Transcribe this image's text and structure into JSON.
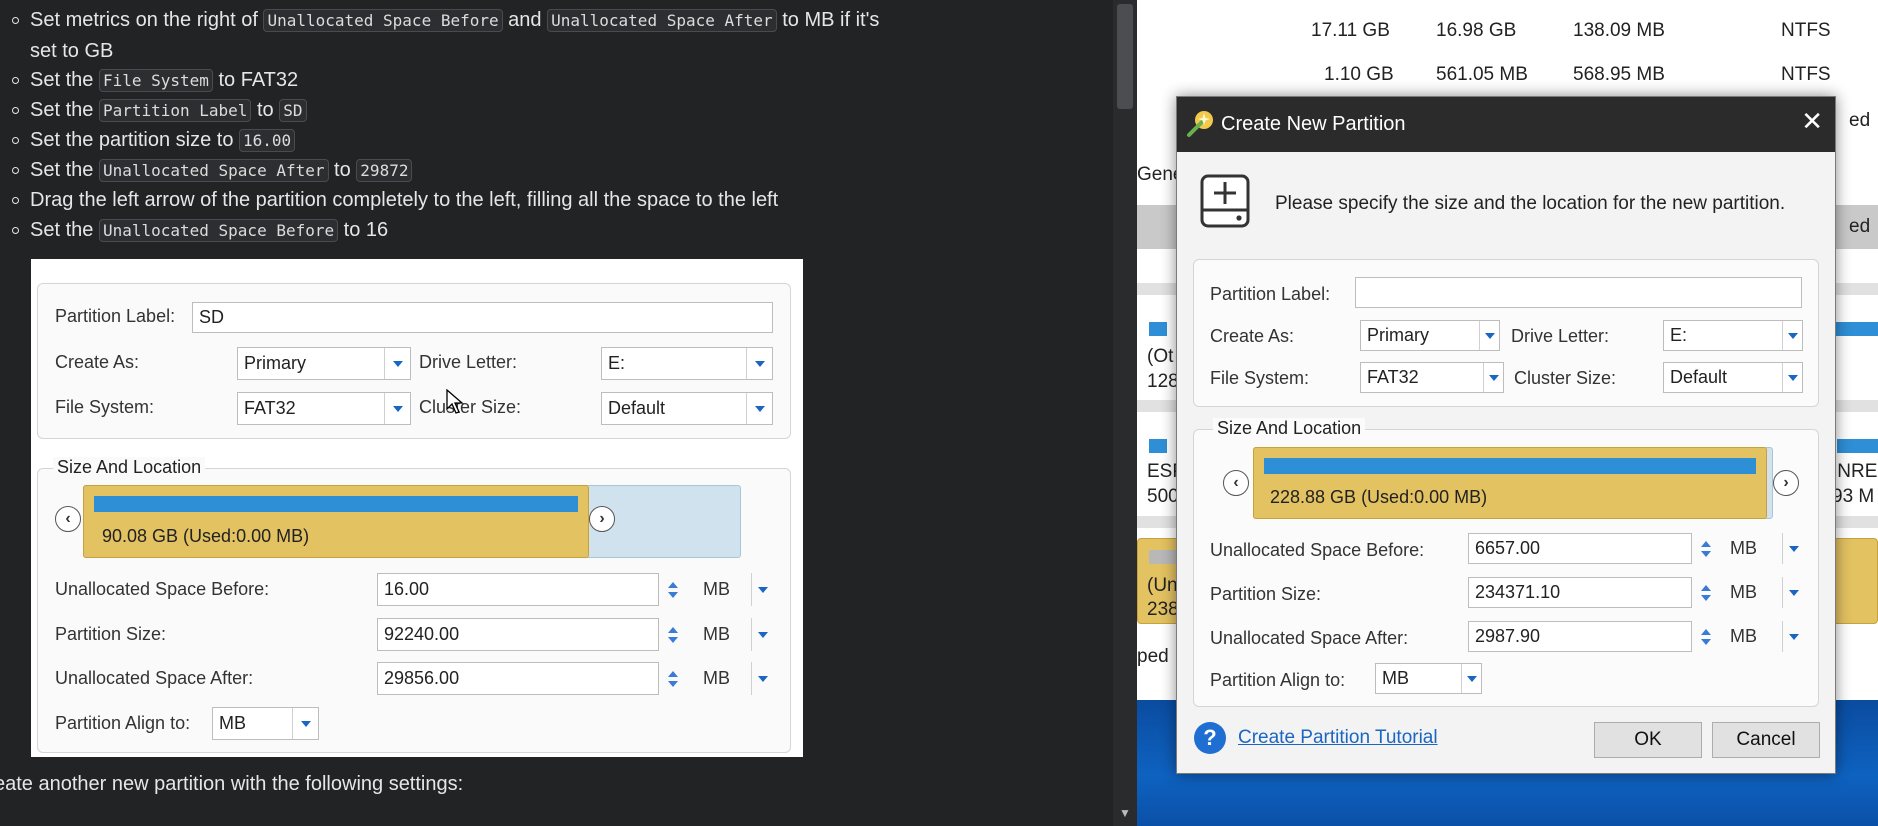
{
  "doc": {
    "bullets": [
      {
        "parts": [
          {
            "t": "text",
            "v": "Set metrics on the right of "
          },
          {
            "t": "code",
            "v": "Unallocated Space Before"
          },
          {
            "t": "text",
            "v": " and "
          },
          {
            "t": "code",
            "v": "Unallocated Space After"
          },
          {
            "t": "text",
            "v": " to MB if it's"
          }
        ],
        "cont": "set to GB"
      },
      {
        "parts": [
          {
            "t": "text",
            "v": "Set the "
          },
          {
            "t": "code",
            "v": "File System"
          },
          {
            "t": "text",
            "v": " to FAT32"
          }
        ]
      },
      {
        "parts": [
          {
            "t": "text",
            "v": "Set the "
          },
          {
            "t": "code",
            "v": "Partition Label"
          },
          {
            "t": "text",
            "v": " to "
          },
          {
            "t": "code",
            "v": "SD"
          }
        ]
      },
      {
        "parts": [
          {
            "t": "text",
            "v": "Set the partition size to "
          },
          {
            "t": "code",
            "v": "16.00"
          }
        ]
      },
      {
        "parts": [
          {
            "t": "text",
            "v": "Set the "
          },
          {
            "t": "code",
            "v": "Unallocated Space After"
          },
          {
            "t": "text",
            "v": " to "
          },
          {
            "t": "code",
            "v": "29872"
          }
        ]
      },
      {
        "parts": [
          {
            "t": "text",
            "v": "Drag the left arrow of the partition completely to the left, filling all the space to the left"
          }
        ]
      },
      {
        "parts": [
          {
            "t": "text",
            "v": "Set the "
          },
          {
            "t": "code",
            "v": "Unallocated Space Before"
          },
          {
            "t": "text",
            "v": " to 16"
          }
        ]
      }
    ],
    "bottom_text": "eate another new partition with the following settings:"
  },
  "embedded": {
    "partition_label_lbl": "Partition Label:",
    "partition_label_val": "SD",
    "create_as_lbl": "Create As:",
    "create_as_val": "Primary",
    "drive_letter_lbl": "Drive Letter:",
    "drive_letter_val": "E:",
    "file_system_lbl": "File System:",
    "file_system_val": "FAT32",
    "cluster_size_lbl": "Cluster Size:",
    "cluster_size_val": "Default",
    "size_location_lbl": "Size And Location",
    "bar_text": "90.08 GB (Used:0.00 MB)",
    "uns_before_lbl": "Unallocated Space Before:",
    "uns_before_val": "16.00",
    "part_size_lbl": "Partition Size:",
    "part_size_val": "92240.00",
    "uns_after_lbl": "Unallocated Space After:",
    "uns_after_val": "29856.00",
    "unit": "MB",
    "align_lbl": "Partition Align to:",
    "align_val": "MB"
  },
  "bgapp": {
    "rows": [
      {
        "cap": "17.11 GB",
        "used": "16.98 GB",
        "unused": "138.09 MB",
        "fs": "NTFS"
      },
      {
        "cap": "1.10 GB",
        "used": "561.05 MB",
        "unused": "568.95 MB",
        "fs": "NTFS"
      }
    ],
    "frags": [
      "ed",
      "Gene",
      "ed",
      "(Ot",
      "128",
      "ESP",
      "500",
      "INRE",
      "93 M",
      "(Un",
      "238",
      "ped"
    ]
  },
  "dialog": {
    "title": "Create New Partition",
    "close": "✕",
    "instruction": "Please specify the size and the location for the new partition.",
    "partition_label_lbl": "Partition Label:",
    "partition_label_val": "",
    "create_as_lbl": "Create As:",
    "create_as_val": "Primary",
    "drive_letter_lbl": "Drive Letter:",
    "drive_letter_val": "E:",
    "file_system_lbl": "File System:",
    "file_system_val": "FAT32",
    "cluster_size_lbl": "Cluster Size:",
    "cluster_size_val": "Default",
    "size_location_lbl": "Size And Location",
    "bar_text": "228.88 GB (Used:0.00 MB)",
    "uns_before_lbl": "Unallocated Space Before:",
    "uns_before_val": "6657.00",
    "part_size_lbl": "Partition Size:",
    "part_size_val": "234371.10",
    "uns_after_lbl": "Unallocated Space After:",
    "uns_after_val": "2987.90",
    "unit": "MB",
    "align_lbl": "Partition Align to:",
    "align_val": "MB",
    "help_q": "?",
    "tutorial_link": "Create Partition Tutorial",
    "ok": "OK",
    "cancel": "Cancel"
  }
}
